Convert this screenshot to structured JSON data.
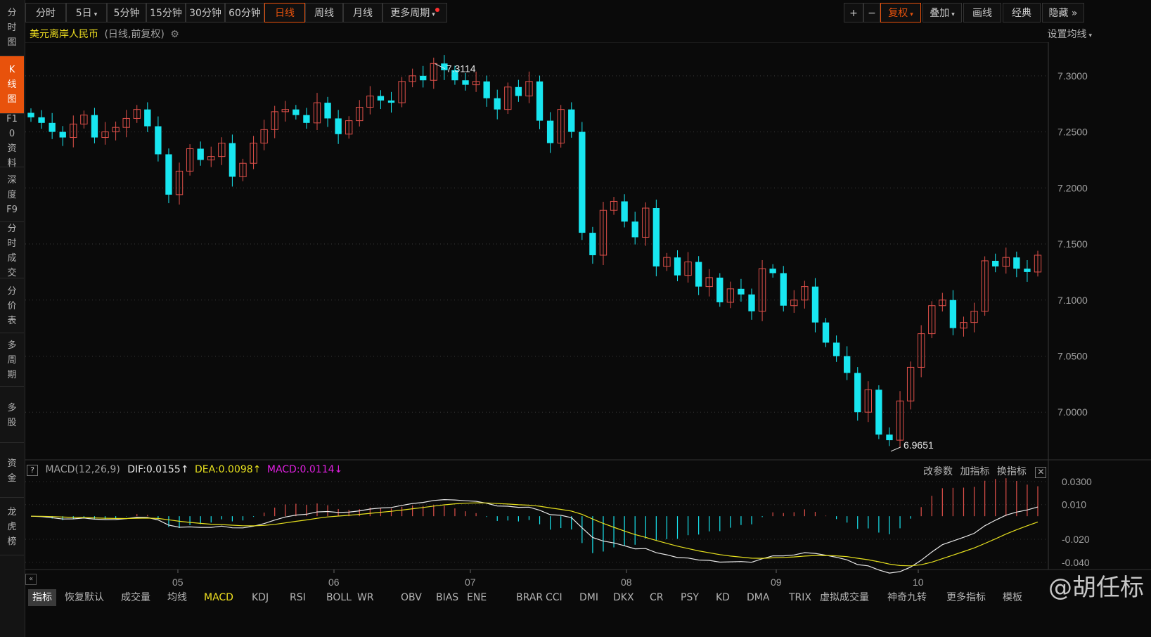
{
  "sidebar": [
    {
      "label": "分时图",
      "active": false
    },
    {
      "label": "K线图",
      "active": true
    },
    {
      "label": "F10资料",
      "active": false
    },
    {
      "label": "深度F9",
      "active": false
    },
    {
      "label": "分时成交",
      "active": false
    },
    {
      "label": "分价表",
      "active": false
    },
    {
      "label": "多周期",
      "active": false
    },
    {
      "label": "多股",
      "active": false
    },
    {
      "label": "资金",
      "active": false
    },
    {
      "label": "龙虎榜",
      "active": false
    }
  ],
  "toolbar": {
    "periods": [
      "分时",
      "5日",
      "5分钟",
      "15分钟",
      "30分钟",
      "60分钟",
      "日线",
      "周线",
      "月线",
      "更多周期"
    ],
    "active_period": "日线",
    "right_buttons": [
      "+",
      "−",
      "复权",
      "叠加",
      "画线",
      "经典",
      "隐藏"
    ]
  },
  "info": {
    "title": "美元离岸人民币",
    "subtitle": "(日线,前复权)",
    "ma_setting": "设置均线"
  },
  "price_axis": [
    "7.3000",
    "7.2500",
    "7.2000",
    "7.1500",
    "7.1000",
    "7.0500",
    "7.0000"
  ],
  "annotations": {
    "high": "7.3114",
    "low": "6.9651"
  },
  "macd": {
    "help": "?",
    "name": "MACD(12,26,9)",
    "dif": "DIF:0.0155",
    "dea": "DEA:0.0098",
    "macd": "MACD:0.0114",
    "actions": [
      "改参数",
      "加指标",
      "换指标"
    ],
    "axis": [
      "0.0300",
      "0.010",
      "-0.020",
      "-0.040"
    ]
  },
  "date_axis": [
    "05",
    "06",
    "07",
    "08",
    "09",
    "10"
  ],
  "bottom_tabs": [
    "指标",
    "恢复默认",
    "成交量",
    "均线",
    "MACD",
    "KDJ",
    "RSI",
    "BOLL",
    "WR",
    "OBV",
    "BIAS",
    "ENE",
    "BRAR",
    "CCI",
    "DMI",
    "DKX",
    "CR",
    "PSY",
    "KD",
    "DMA",
    "TRIX",
    "虚拟成交量",
    "神奇九转",
    "更多指标",
    "模板"
  ],
  "watermark": "@胡任标",
  "colors": {
    "up": "#e0504a",
    "down": "#18e6f0",
    "accent": "#e8520c",
    "dif": "#e8e8e8",
    "dea": "#e6e01e",
    "macd": "#e020e0"
  },
  "chart_data": {
    "type": "candlestick",
    "title": "美元离岸人民币",
    "ylim": [
      6.96,
      7.33
    ],
    "x": [
      "05",
      "06",
      "07",
      "08",
      "09",
      "10"
    ],
    "candles_close": [
      7.263,
      7.258,
      7.25,
      7.245,
      7.257,
      7.265,
      7.245,
      7.25,
      7.254,
      7.262,
      7.27,
      7.255,
      7.23,
      7.194,
      7.215,
      7.235,
      7.225,
      7.228,
      7.24,
      7.21,
      7.222,
      7.24,
      7.252,
      7.268,
      7.27,
      7.265,
      7.258,
      7.276,
      7.262,
      7.248,
      7.26,
      7.272,
      7.282,
      7.278,
      7.276,
      7.295,
      7.3,
      7.296,
      7.311,
      7.305,
      7.296,
      7.292,
      7.295,
      7.28,
      7.27,
      7.29,
      7.282,
      7.295,
      7.26,
      7.24,
      7.27,
      7.25,
      7.16,
      7.14,
      7.18,
      7.188,
      7.17,
      7.156,
      7.182,
      7.13,
      7.138,
      7.122,
      7.134,
      7.112,
      7.12,
      7.098,
      7.11,
      7.105,
      7.09,
      7.128,
      7.124,
      7.095,
      7.1,
      7.112,
      7.08,
      7.062,
      7.05,
      7.035,
      7.0,
      7.02,
      6.98,
      6.975,
      7.01,
      7.04,
      7.07,
      7.095,
      7.1,
      7.075,
      7.08,
      7.09,
      7.135,
      7.13,
      7.138,
      7.128,
      7.125,
      7.14
    ],
    "high": "7.3114",
    "low": "6.9651",
    "macd": {
      "dif": 0.0155,
      "dea": 0.0098,
      "macd": 0.0114
    }
  }
}
